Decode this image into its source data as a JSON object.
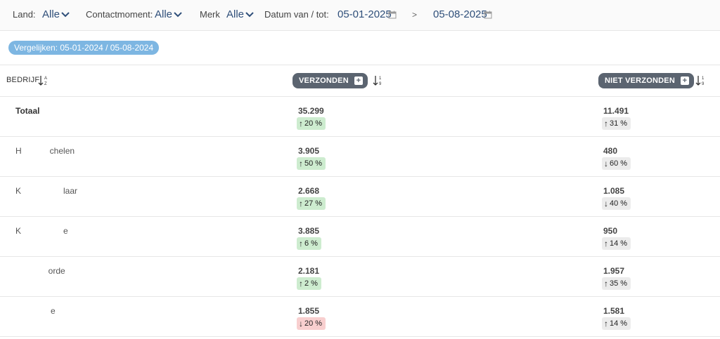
{
  "filters": {
    "land_label": "Land:",
    "land_value": "Alle",
    "contact_label": "Contactmoment:",
    "contact_value": "Alle",
    "merk_label": "Merk",
    "merk_value": "Alle",
    "datum_label": "Datum van / tot:",
    "date_from": "05-01-2025",
    "separator": ">",
    "date_to": "05-08-2025"
  },
  "compare": {
    "label": "Vergelijken: 05-01-2024 / 05-08-2024"
  },
  "table": {
    "col_bedrijf": "BEDRIJF",
    "col_verzonden": "VERZONDEN",
    "col_niet_verzonden": "NIET VERZONDEN",
    "rows": [
      {
        "name": "Totaal",
        "verzonden": "35.299",
        "verzonden_change": "20 %",
        "verzonden_dir": "up",
        "niet": "11.491",
        "niet_change": "31 %",
        "niet_dir": "up"
      },
      {
        "name": "H            chelen",
        "verzonden": "3.905",
        "verzonden_change": "50 %",
        "verzonden_dir": "up",
        "niet": "480",
        "niet_change": "60 %",
        "niet_dir": "down"
      },
      {
        "name": "K                  laar",
        "verzonden": "2.668",
        "verzonden_change": "27 %",
        "verzonden_dir": "up",
        "niet": "1.085",
        "niet_change": "40 %",
        "niet_dir": "down"
      },
      {
        "name": "K                  e",
        "verzonden": "3.885",
        "verzonden_change": "6 %",
        "verzonden_dir": "up",
        "niet": "950",
        "niet_change": "14 %",
        "niet_dir": "up"
      },
      {
        "name": "              orde",
        "verzonden": "2.181",
        "verzonden_change": "2 %",
        "verzonden_dir": "up",
        "niet": "1.957",
        "niet_change": "35 %",
        "niet_dir": "up"
      },
      {
        "name": "               e",
        "verzonden": "1.855",
        "verzonden_change": "20 %",
        "verzonden_dir": "down",
        "niet": "1.581",
        "niet_change": "14 %",
        "niet_dir": "up"
      }
    ]
  },
  "colors": {
    "positive": "#cdeccf",
    "negative": "#f8cfcf",
    "neutral": "#ececec",
    "pill": "#7db6e2",
    "header_btn": "#5b6470"
  },
  "icons": {
    "dropdown": "chevron-down-icon",
    "calendar": "calendar-icon",
    "sort_alpha": "sort-alpha-icon",
    "sort_numeric": "sort-numeric-icon",
    "plus": "plus-icon"
  }
}
